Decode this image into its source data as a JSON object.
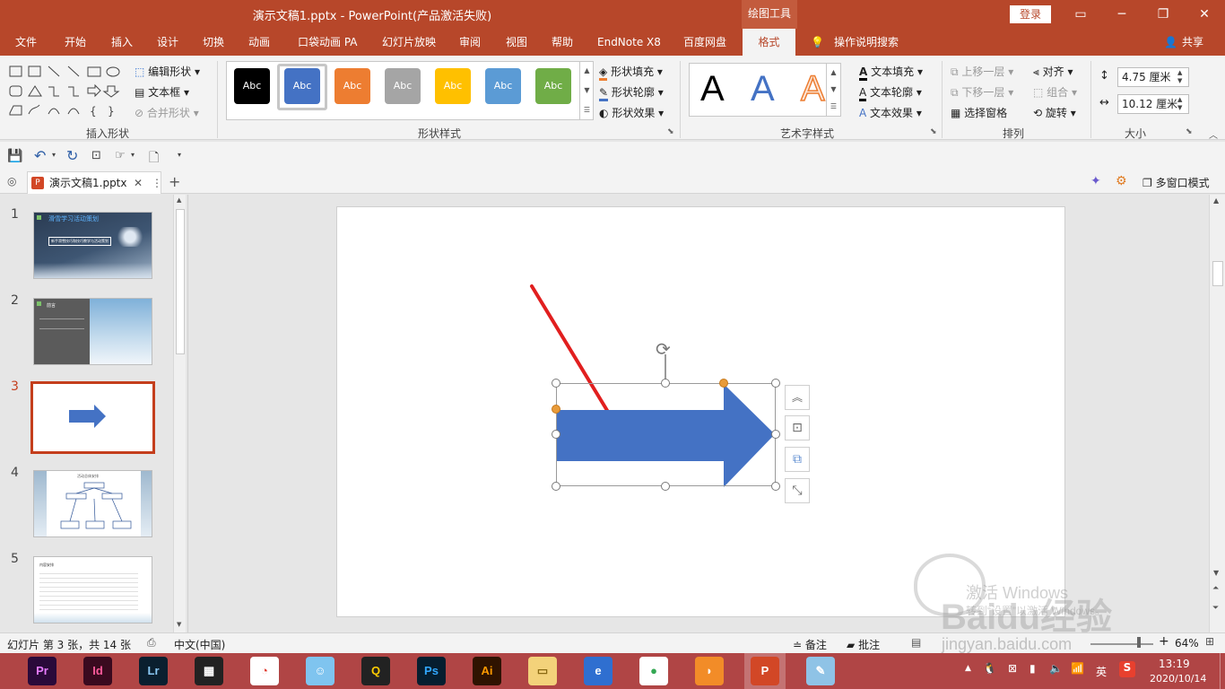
{
  "window": {
    "title": "演示文稿1.pptx  -  PowerPoint(产品激活失败)",
    "context_tab": "绘图工具",
    "login": "登录"
  },
  "ribbon_tabs": [
    "文件",
    "开始",
    "插入",
    "设计",
    "切换",
    "动画",
    "口袋动画 PA",
    "幻灯片放映",
    "审阅",
    "视图",
    "帮助",
    "EndNote X8",
    "百度网盘",
    "格式"
  ],
  "active_tab": "格式",
  "tell_me": "操作说明搜索",
  "share": "共享",
  "ribbon": {
    "insert_shapes": {
      "label": "插入形状",
      "edit_shape": "编辑形状",
      "text_box": "文本框",
      "merge_shapes": "合并形状"
    },
    "shape_styles": {
      "label": "形状样式",
      "sample_text": "Abc",
      "swatches": [
        "#000000",
        "#4472c4",
        "#ed7d31",
        "#a5a5a5",
        "#ffc000",
        "#5b9bd5",
        "#70ad47"
      ],
      "fill": "形状填充",
      "outline": "形状轮廓",
      "effects": "形状效果"
    },
    "wordart": {
      "label": "艺术字样式",
      "letter": "A",
      "text_fill": "文本填充",
      "text_outline": "文本轮廓",
      "text_effects": "文本效果"
    },
    "arrange": {
      "label": "排列",
      "bring_forward": "上移一层",
      "send_backward": "下移一层",
      "selection_pane": "选择窗格",
      "align": "对齐",
      "group": "组合",
      "rotate": "旋转"
    },
    "size": {
      "label": "大小",
      "height": "4.75 厘米",
      "width": "10.12 厘米"
    }
  },
  "doc_tab": {
    "name": "演示文稿1.pptx",
    "icon_letter": "P",
    "multi_window": "多窗口模式"
  },
  "slides": [
    {
      "num": "1",
      "title": "滑雪学习活动策划",
      "subtitle": "新手滑雪技巧和技巧教学与活动策划"
    },
    {
      "num": "2",
      "title": "前言"
    },
    {
      "num": "3",
      "current": true
    },
    {
      "num": "4",
      "title": "活动总体安排"
    },
    {
      "num": "5",
      "title": "内容安排"
    }
  ],
  "status": {
    "slide_info": "幻灯片 第 3 张，共 14 张",
    "language": "中文(中国)",
    "notes": "备注",
    "comments": "批注",
    "zoom": "64%"
  },
  "watermark": {
    "activate_cn": "激活 Windows",
    "goto_settings": "转到“设置”以激活 Windows。",
    "brand": "Baidu经验",
    "url": "jingyan.baidu.com"
  },
  "taskbar": {
    "apps": [
      {
        "name": "premiere",
        "label": "Pr",
        "bg": "#2a0a3a",
        "fg": "#e77cff"
      },
      {
        "name": "indesign",
        "label": "Id",
        "bg": "#3a0a1f",
        "fg": "#ff5a9a"
      },
      {
        "name": "lightroom",
        "label": "Lr",
        "bg": "#0a1f2f",
        "fg": "#8ac8f4"
      },
      {
        "name": "video-editor",
        "label": "▦",
        "bg": "#222222",
        "fg": "#ffffff"
      },
      {
        "name": "color-app",
        "label": "◔",
        "bg": "#ffffff",
        "fg": "#e03c31"
      },
      {
        "name": "qq-pet",
        "label": "☺",
        "bg": "#7fc4ef",
        "fg": "#ffffff"
      },
      {
        "name": "qq",
        "label": "Q",
        "bg": "#222222",
        "fg": "#ffcc00"
      },
      {
        "name": "photoshop",
        "label": "Ps",
        "bg": "#061e2f",
        "fg": "#31a8ff"
      },
      {
        "name": "illustrator",
        "label": "Ai",
        "bg": "#2f1300",
        "fg": "#ff9a00"
      },
      {
        "name": "file-explorer",
        "label": "▭",
        "bg": "#f3d27a",
        "fg": "#8a6a12"
      },
      {
        "name": "browser-edge",
        "label": "e",
        "bg": "#2f6fd0",
        "fg": "#ffffff"
      },
      {
        "name": "chrome",
        "label": "●",
        "bg": "#ffffff",
        "fg": "#34a853"
      },
      {
        "name": "fox-app",
        "label": "◗",
        "bg": "#f28c28",
        "fg": "#ffffff"
      },
      {
        "name": "powerpoint",
        "label": "P",
        "bg": "#d24726",
        "fg": "#ffffff",
        "active": true
      },
      {
        "name": "notepad",
        "label": "✎",
        "bg": "#8fc3e6",
        "fg": "#ffffff"
      }
    ],
    "ime": "英",
    "time": "13:19",
    "date": "2020/10/14"
  }
}
